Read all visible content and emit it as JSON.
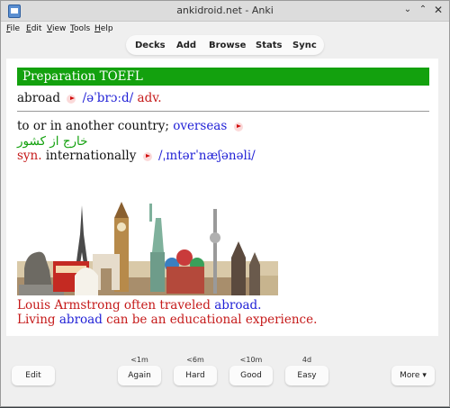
{
  "window": {
    "title": "ankidroid.net - Anki"
  },
  "menu": [
    "File",
    "Edit",
    "View",
    "Tools",
    "Help"
  ],
  "toolbar": [
    "Decks",
    "Add",
    "Browse",
    "Stats",
    "Sync"
  ],
  "card": {
    "deck_title": "Preparation TOEFL",
    "word": "abroad",
    "pronunciation": "/əˈbrɔːd/",
    "pos": "adv.",
    "definition": "to or in another country;",
    "synonym_link": "overseas",
    "persian": "خارج از کشور",
    "syn_label": "syn.",
    "syn_word": "internationally",
    "syn_pron": "/ˌɪntərˈnæʃənəli/",
    "example1_pre": "Louis Armstrong often traveled",
    "example1_word": "abroad.",
    "example2_pre": "Living",
    "example2_word": "abroad",
    "example2_post": "can be an educational experience."
  },
  "answers": {
    "edit_label": "Edit",
    "more_label": "More ▾",
    "buttons": [
      {
        "label": "Again",
        "time": "<1m"
      },
      {
        "label": "Hard",
        "time": "<6m"
      },
      {
        "label": "Good",
        "time": "<10m"
      },
      {
        "label": "Easy",
        "time": "4d"
      }
    ]
  },
  "colors": {
    "deck_bar": "#13a10e",
    "accent_red": "#c51a1a",
    "accent_blue": "#1f1fd6"
  }
}
